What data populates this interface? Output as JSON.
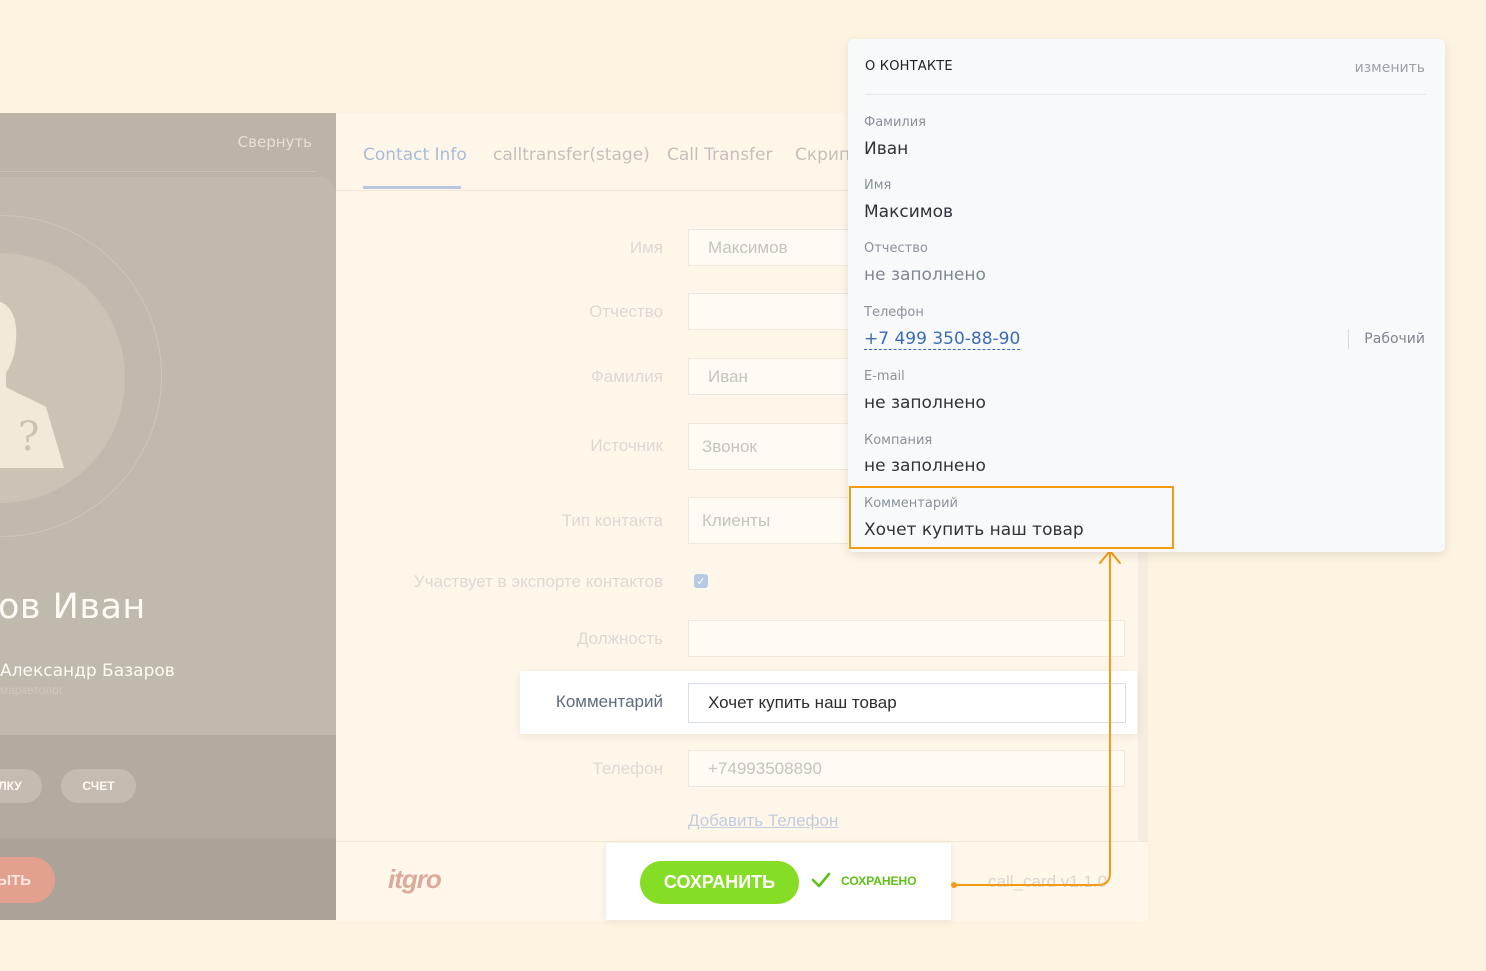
{
  "left_panel": {
    "collapse": "Свернуть",
    "contact_name": "ов Иван",
    "owner_name": "Александр Базаров",
    "owner_role": "маркетолог",
    "deal_button": "ЕЛКУ",
    "invoice_button": "СЧЕТ",
    "close_button": "ЫТЬ"
  },
  "tabs": [
    "Contact Info",
    "calltransfer(stage)",
    "Call Transfer",
    "Скрипт"
  ],
  "form": {
    "first_name": {
      "label": "Имя",
      "value": "Максимов"
    },
    "middle_name": {
      "label": "Отчество",
      "value": ""
    },
    "last_name": {
      "label": "Фамилия",
      "value": "Иван"
    },
    "source": {
      "label": "Источник",
      "value": "Звонок"
    },
    "contact_type": {
      "label": "Тип контакта",
      "value": "Клиенты"
    },
    "export": {
      "label": "Участвует в экспорте контактов",
      "checked": true
    },
    "position": {
      "label": "Должность",
      "value": ""
    },
    "comment": {
      "label": "Комментарий",
      "value": "Хочет купить наш товар"
    },
    "phone": {
      "label": "Телефон",
      "value": "+74993508890"
    },
    "add_phone": "Добавить Телефон"
  },
  "footer": {
    "logo": "itgro",
    "save_button": "СОХРАНИТЬ",
    "saved_status": "СОХРАНЕНО",
    "version": "call_card v1.1.0"
  },
  "popup": {
    "title": "О КОНТАКТЕ",
    "edit": "изменить",
    "fields": {
      "last_name": {
        "label": "Фамилия",
        "value": "Иван"
      },
      "first_name": {
        "label": "Имя",
        "value": "Максимов"
      },
      "middle_name": {
        "label": "Отчество",
        "value": "не заполнено"
      },
      "phone": {
        "label": "Телефон",
        "value": "+7 499 350-88-90",
        "type": "Рабочий"
      },
      "email": {
        "label": "E-mail",
        "value": "не заполнено"
      },
      "company": {
        "label": "Компания",
        "value": "не заполнено"
      },
      "comment": {
        "label": "Комментарий",
        "value": "Хочет купить наш товар"
      }
    }
  },
  "colors": {
    "background": "#fef3e1",
    "accent_highlight": "#f39c12",
    "save_green": "#86dd25",
    "link_blue": "#3b6cb4"
  },
  "icons": [
    "user-silhouette-icon",
    "check-icon",
    "checkbox-checked-icon"
  ]
}
